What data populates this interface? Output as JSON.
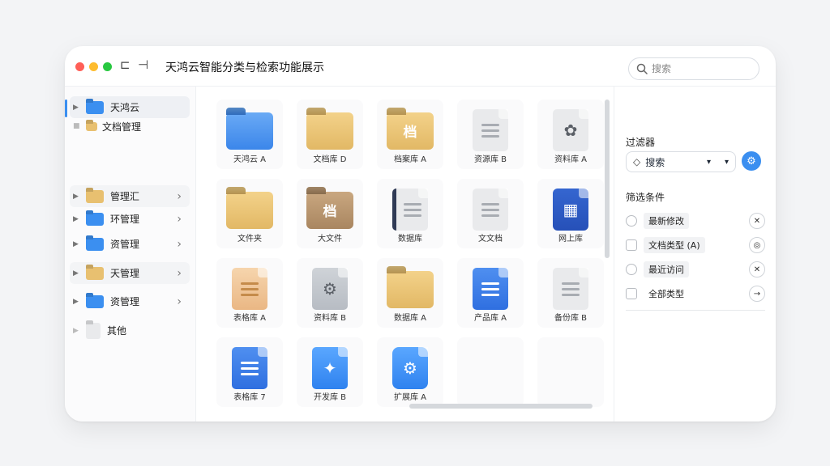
{
  "window": {
    "title": "天鸿云智能分类与检索功能展示"
  },
  "toolbar": {
    "sidebar_toggle_glyph": "⊏",
    "nav_glyph": "⊣"
  },
  "search": {
    "placeholder": "搜索"
  },
  "sidebar": {
    "items": [
      {
        "label": "天鸿云"
      },
      {
        "label": "文档管理"
      },
      {
        "label": "管理汇"
      },
      {
        "label": "环管理"
      },
      {
        "label": "资管理"
      },
      {
        "label": "天管理"
      },
      {
        "label": "资管理"
      },
      {
        "label": "其他"
      }
    ]
  },
  "grid": {
    "tiles": [
      {
        "label": "天鸿云 A"
      },
      {
        "label": "文档库 D"
      },
      {
        "label": "档案库 A",
        "tag": "档"
      },
      {
        "label": "资源库 B"
      },
      {
        "label": "资料库 A"
      },
      {
        "label": "文件夹"
      },
      {
        "label": "大文件",
        "tag": "档"
      },
      {
        "label": "数据库"
      },
      {
        "label": "文文档"
      },
      {
        "label": "网上库"
      },
      {
        "label": "表格库 A"
      },
      {
        "label": "资料库 B"
      },
      {
        "label": "数据库 A"
      },
      {
        "label": "产品库 A"
      },
      {
        "label": "备份库 B"
      },
      {
        "label": "表格库 7"
      },
      {
        "label": "开发库 B"
      },
      {
        "label": "扩展库 A"
      }
    ]
  },
  "panel": {
    "filter_heading": "过滤器",
    "filter_select_value": "搜索",
    "options_heading": "筛选条件",
    "options": [
      {
        "label": "最新修改",
        "action": "✕"
      },
      {
        "label": "文档类型 (A)",
        "action": "◎"
      },
      {
        "label": "最近访问",
        "action": "✕"
      },
      {
        "label": "全部类型",
        "action": "→"
      }
    ]
  },
  "colors": {
    "accent": "#3b8ff0",
    "folder_blue": "#3b86ea",
    "folder_tan": "#e2b865"
  }
}
